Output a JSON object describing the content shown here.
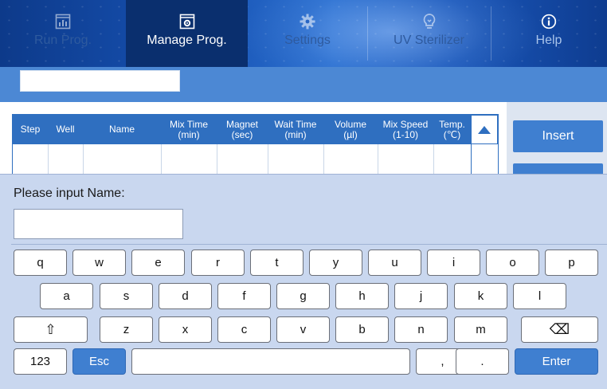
{
  "nav": {
    "tabs": [
      {
        "label": "Run Prog.",
        "icon": "bar-chart-icon",
        "state": "dimmed"
      },
      {
        "label": "Manage Prog.",
        "icon": "settings-window-icon",
        "state": "active"
      },
      {
        "label": "Settings",
        "icon": "gear-icon",
        "state": "dimmed"
      },
      {
        "label": "UV Sterilizer",
        "icon": "bulb-icon",
        "state": "dimmed"
      },
      {
        "label": "Help",
        "icon": "info-icon",
        "state": "normal"
      }
    ]
  },
  "program_name": "",
  "table": {
    "headers": [
      {
        "line1": "Step",
        "line2": ""
      },
      {
        "line1": "Well",
        "line2": ""
      },
      {
        "line1": "Name",
        "line2": ""
      },
      {
        "line1": "Mix Time",
        "line2": "(min)"
      },
      {
        "line1": "Magnet",
        "line2": "(sec)"
      },
      {
        "line1": "Wait Time",
        "line2": "(min)"
      },
      {
        "line1": "Volume",
        "line2": "(µl)"
      },
      {
        "line1": "Mix Speed",
        "line2": "(1-10)"
      },
      {
        "line1": "Temp.",
        "line2": "(℃)"
      }
    ],
    "rows": []
  },
  "actions": {
    "insert_label": "Insert"
  },
  "keyboard": {
    "prompt": "Please input Name:",
    "input_value": "",
    "row1": [
      "q",
      "w",
      "e",
      "r",
      "t",
      "y",
      "u",
      "i",
      "o",
      "p"
    ],
    "row2": [
      "a",
      "s",
      "d",
      "f",
      "g",
      "h",
      "j",
      "k",
      "l"
    ],
    "row3": {
      "shift": "⇧",
      "letters": [
        "z",
        "x",
        "c",
        "v",
        "b",
        "n",
        "m"
      ],
      "backspace": "⌫"
    },
    "row4": {
      "numbers": "123",
      "esc": "Esc",
      "space": "",
      "comma": ",",
      "period": ".",
      "enter": "Enter"
    }
  },
  "colors": {
    "accent": "#3f7fd0",
    "header_band": "#4c88d4",
    "keyboard_bg": "#c9d7ef"
  }
}
